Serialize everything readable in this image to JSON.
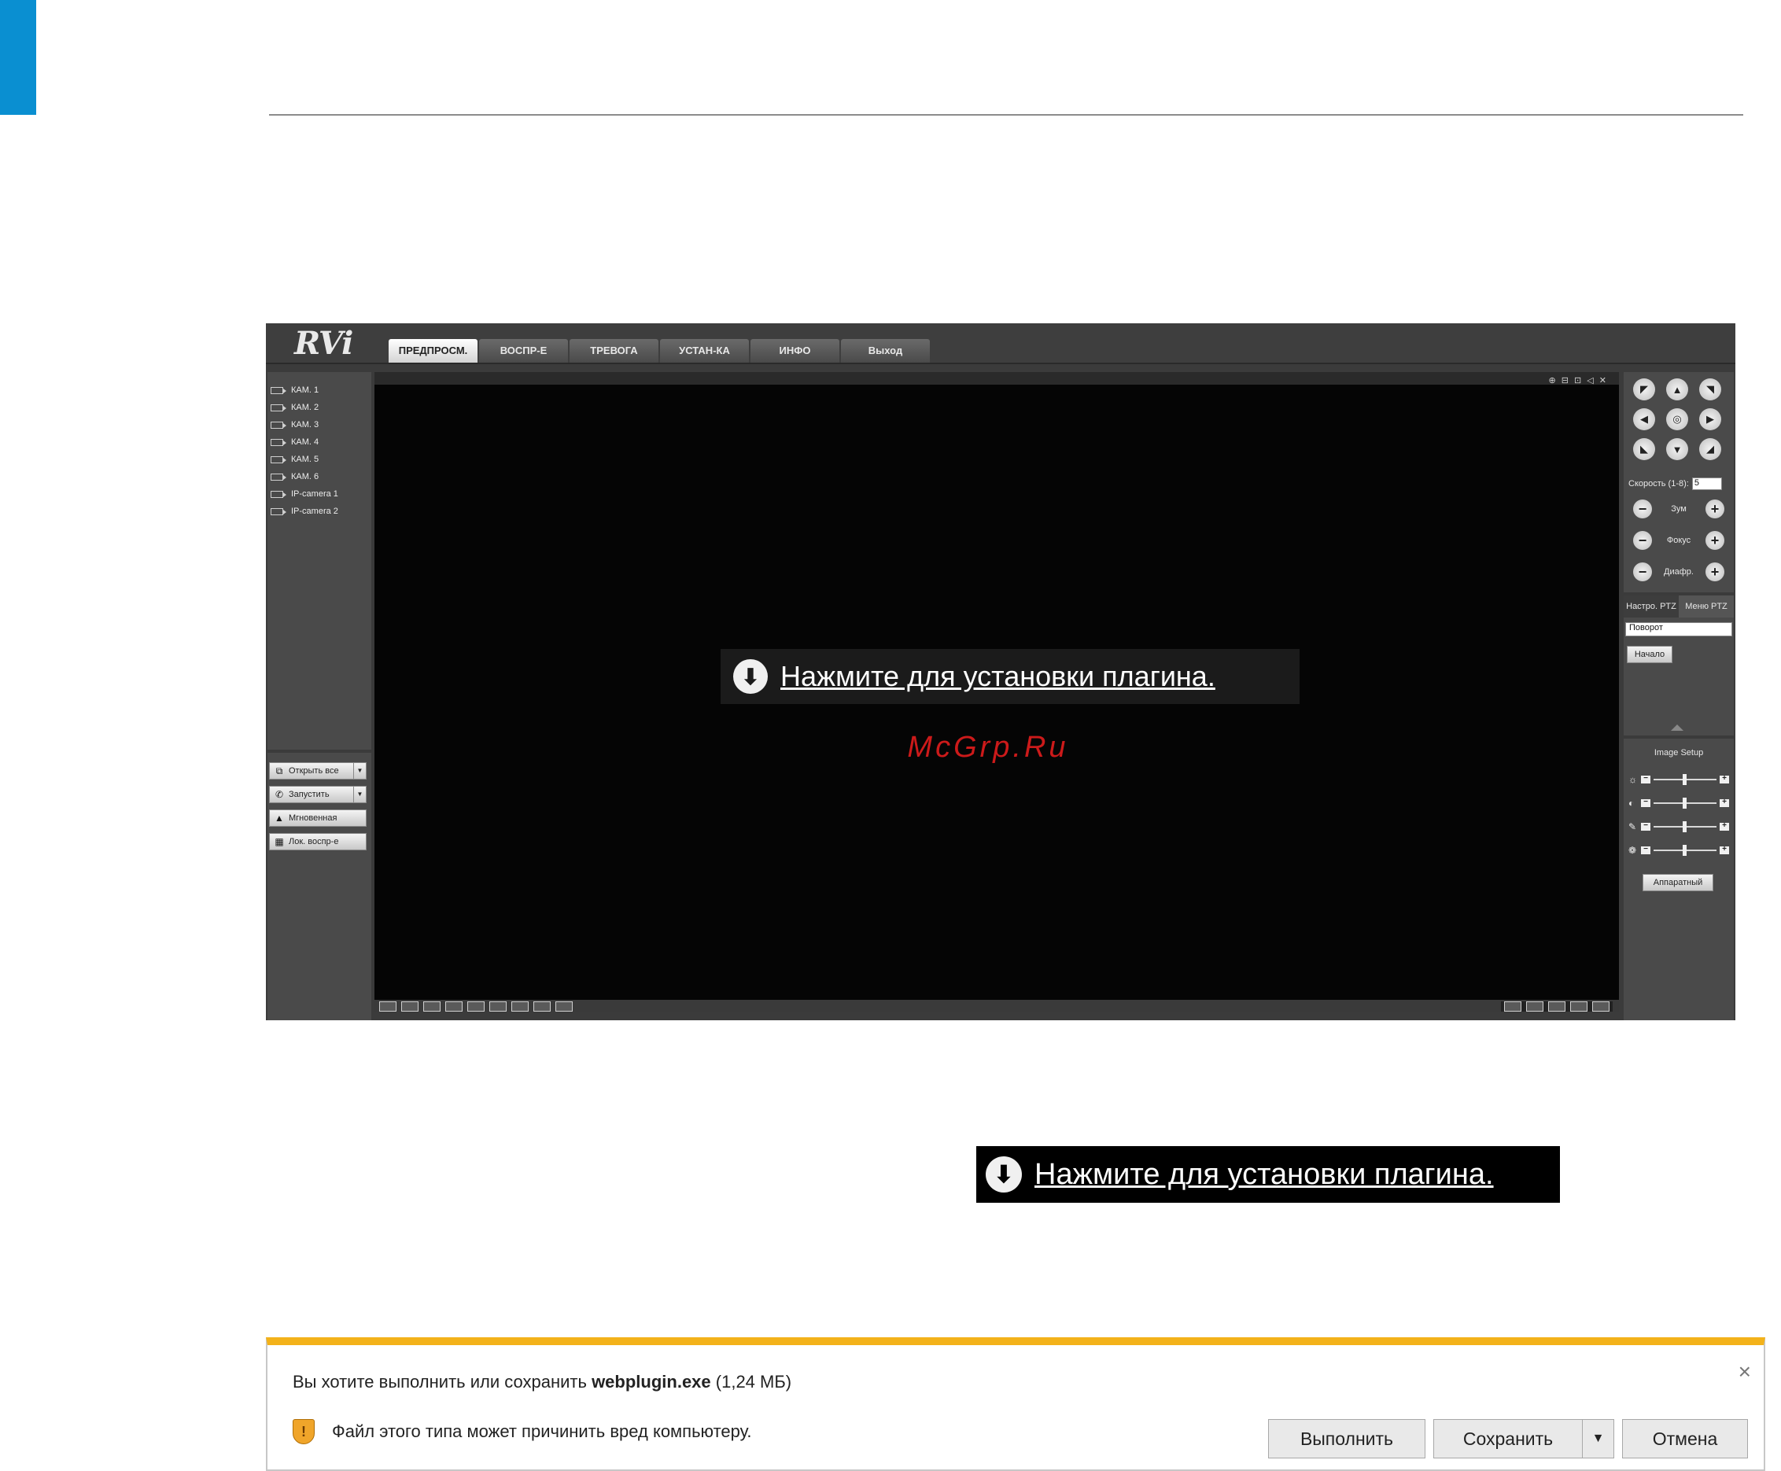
{
  "app": {
    "logo": "RVi",
    "tabs": [
      "ПРЕДПРОСМ.",
      "ВОСПР-Е",
      "ТРЕВОГА",
      "УСТАН-КА",
      "ИНФО",
      "Выход"
    ],
    "cameras": [
      "КАМ. 1",
      "КАМ. 2",
      "КАМ. 3",
      "КАМ. 4",
      "КАМ. 5",
      "КАМ. 6",
      "IP-camera 1",
      "IP-camera 2"
    ],
    "actions": {
      "open_all": "Открыть все",
      "start": "Запустить",
      "snapshot": "Мгновенная",
      "local_playback": "Лок. воспр-е"
    },
    "video_tools": "⊕ ⊟ ⊡ ◁ ✕",
    "plugin_link": "Нажмите для установки плагина.",
    "watermark": "McGrp.Ru",
    "ptz": {
      "speed_label": "Скорость (1-8):",
      "speed_value": "5",
      "zoom": "Зум",
      "focus": "Фокус",
      "iris": "Диафр."
    },
    "ptz_config": {
      "tab_settings": "Настро. PTZ",
      "tab_menu": "Меню PTZ",
      "mode_value": "Поворот",
      "start_label": "Начало"
    },
    "image_setup": {
      "title": "Image Setup",
      "hardware_label": "Аппаратный"
    }
  },
  "plugin_banner": {
    "text": "Нажмите для установки плагина."
  },
  "download_bar": {
    "question_prefix": "Вы хотите выполнить или сохранить ",
    "file_name": "webplugin.exe",
    "file_size": " (1,24 МБ)",
    "warning": "Файл этого типа может причинить вред компьютеру.",
    "run_label": "Выполнить",
    "save_label": "Сохранить",
    "cancel_label": "Отмена",
    "close_glyph": "×"
  },
  "colors": {
    "accent_blue": "#0a8fd1",
    "download_bar_accent": "#f3b21a",
    "watermark_red": "#cc1a1a"
  }
}
